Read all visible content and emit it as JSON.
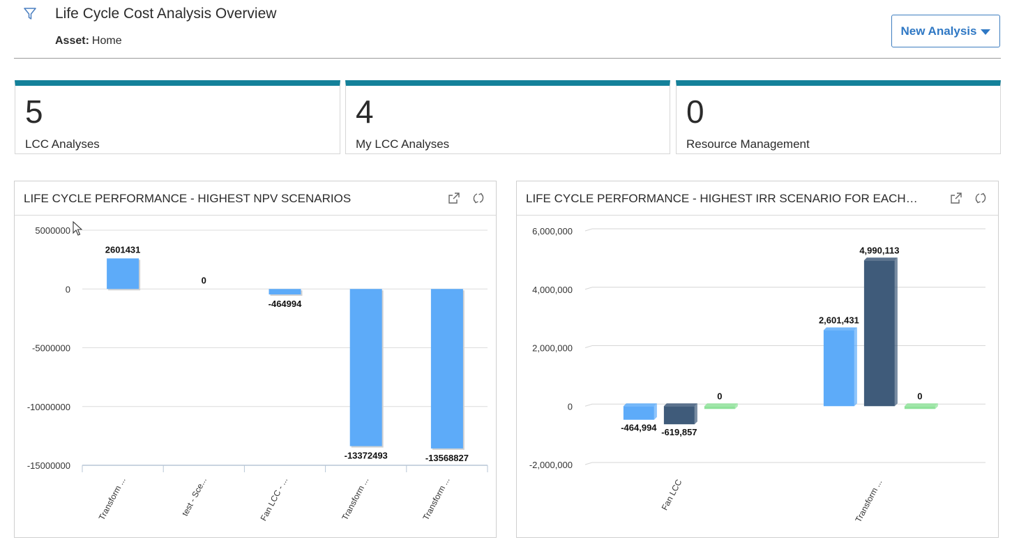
{
  "header": {
    "title": "Life Cycle Cost Analysis Overview",
    "asset_label": "Asset:",
    "asset_value": "Home",
    "new_button_label": "New Analysis",
    "icons": {
      "filter": "filter-icon",
      "dropdown": "caret-down-icon"
    }
  },
  "cards": [
    {
      "value": "5",
      "label": "LCC Analyses"
    },
    {
      "value": "4",
      "label": "My LCC Analyses"
    },
    {
      "value": "0",
      "label": "Resource Management"
    }
  ],
  "colors": {
    "accent": "#14819a",
    "button_text": "#2f78c4",
    "bar_light": "#5dabf9",
    "bar_dark": "#3f5b7a",
    "bar_green": "#8fe29a"
  },
  "panels": [
    {
      "title": "LIFE CYCLE PERFORMANCE - HIGHEST NPV SCENARIOS",
      "icons": [
        "open-external-icon",
        "refresh-icon"
      ]
    },
    {
      "title": "LIFE CYCLE PERFORMANCE - HIGHEST IRR SCENARIO FOR EACH ANAL...",
      "icons": [
        "open-external-icon",
        "refresh-icon"
      ]
    }
  ],
  "chart_data": [
    {
      "type": "bar",
      "categories": [
        "Transform ...",
        "test - Sce...",
        "Fan LCC - ...",
        "Transform ...",
        "Transform ..."
      ],
      "values": [
        2601431,
        0,
        -464994,
        -13372493,
        -13568827
      ],
      "value_labels": [
        "2601431",
        "0",
        "-464994",
        "-13372493",
        "-13568827"
      ],
      "yticks": [
        "5000000",
        "0",
        "-5000000",
        "-10000000",
        "-15000000"
      ],
      "ylim": [
        -15000000,
        5000000
      ],
      "grid": true
    },
    {
      "type": "bar",
      "categories": [
        "Fan LCC",
        "Transform ..."
      ],
      "series": [
        {
          "values": [
            -464994,
            2601431
          ],
          "value_labels": [
            "-464,994",
            "2,601,431"
          ]
        },
        {
          "values": [
            -619857,
            4990113
          ],
          "value_labels": [
            "-619,857",
            "4,990,113"
          ]
        },
        {
          "values": [
            0,
            0
          ],
          "value_labels": [
            "0",
            "0"
          ]
        }
      ],
      "yticks": [
        "6,000,000",
        "4,000,000",
        "2,000,000",
        "0",
        "-2,000,000"
      ],
      "ylim": [
        -2000000,
        6000000
      ],
      "grid": true
    }
  ]
}
